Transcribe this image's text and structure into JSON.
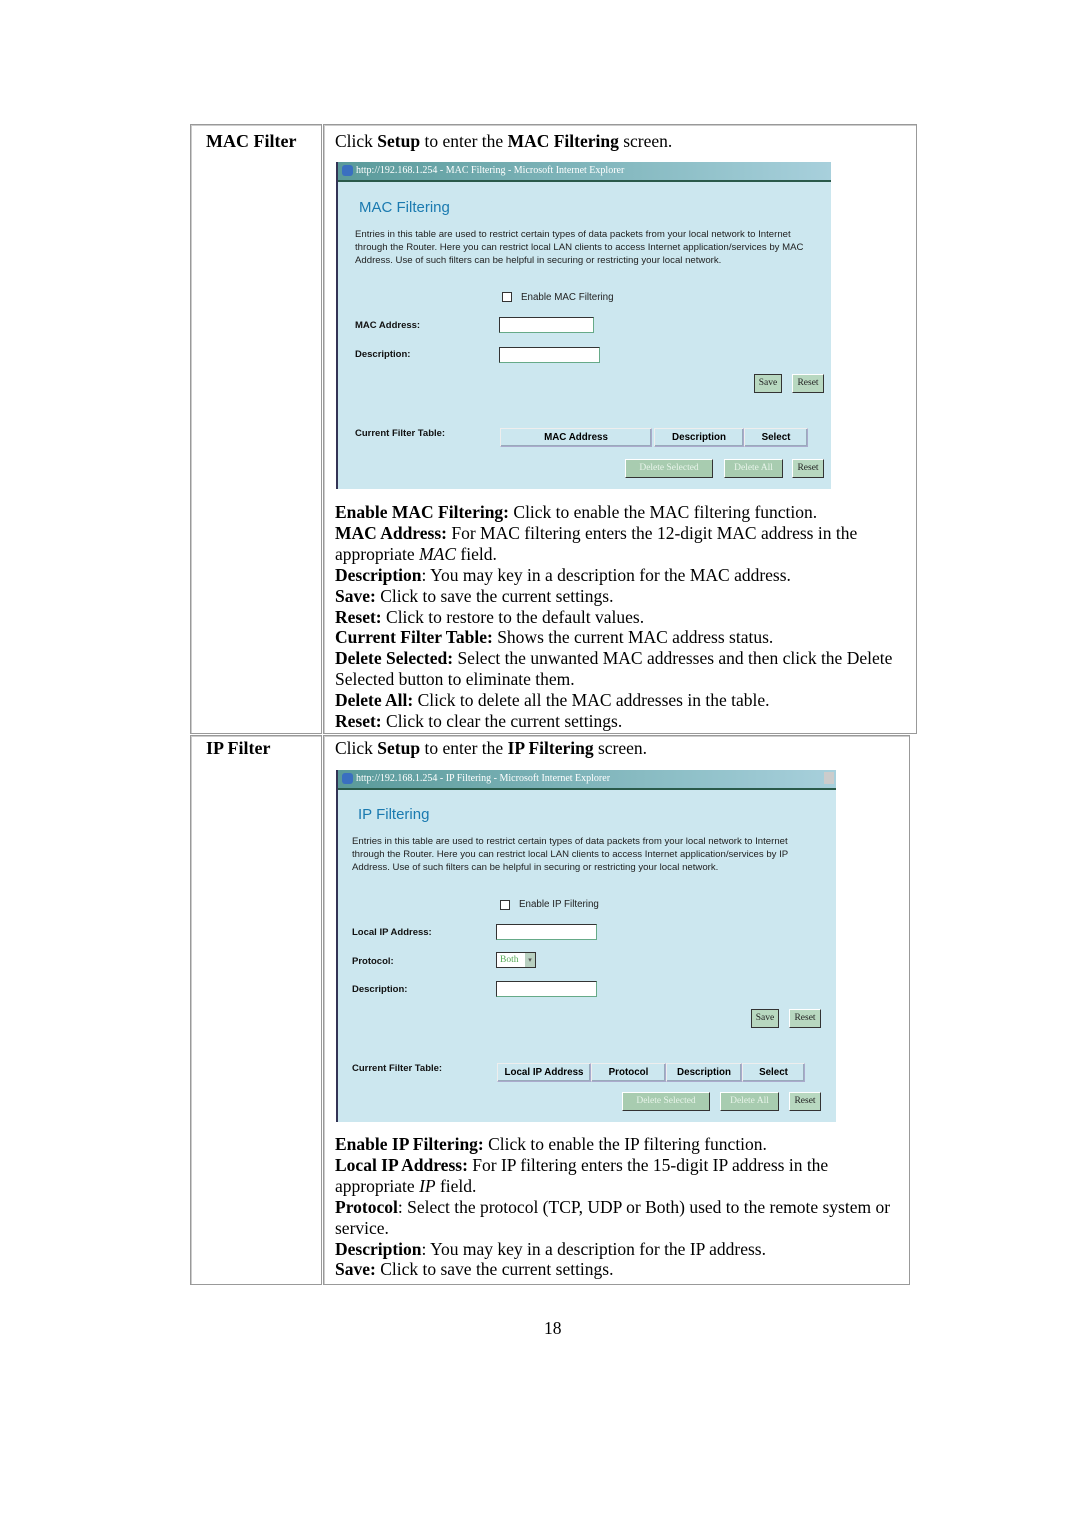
{
  "mac": {
    "label": "MAC Filter",
    "intro": [
      "Click ",
      "Setup",
      " to enter the ",
      "MAC Filtering",
      " screen."
    ],
    "window_title": "http://192.168.1.254 - MAC Filtering - Microsoft Internet Explorer",
    "heading": "MAC Filtering",
    "description": "Entries in this table are used to restrict certain types of data packets from your local network to Internet through the Router. Here you can restrict local LAN clients to access Internet application/services by MAC Address. Use of such filters can be helpful in securing or restricting your local network.",
    "enable_label": "Enable MAC Filtering",
    "enabled": false,
    "mac_label": "MAC Address:",
    "mac_value": "",
    "desc_label": "Description:",
    "desc_value": "",
    "save": "Save",
    "reset": "Reset",
    "table_label": "Current Filter Table:",
    "columns": [
      "MAC Address",
      "Description",
      "Select"
    ],
    "delete_selected": "Delete Selected",
    "delete_all": "Delete All",
    "reset2": "Reset",
    "notes": [
      {
        "term": "Enable MAC Filtering:",
        "text": " Click to enable the MAC filtering function."
      },
      {
        "term": "MAC Address:",
        "text": " For MAC filtering enters the 12-digit MAC address in the appropriate ",
        "em": "MAC",
        "tail": " field."
      },
      {
        "term": "Description",
        "text": ": You may key in a description for the MAC address."
      },
      {
        "term": "Save:",
        "text": " Click to save the current settings."
      },
      {
        "term": "Reset:",
        "text": " Click to restore to the default values."
      },
      {
        "term": "Current Filter Table:",
        "text": " Shows the current MAC address status."
      },
      {
        "term": "Delete Selected:",
        "text": " Select the unwanted MAC addresses and then click the Delete Selected button to eliminate them."
      },
      {
        "term": "Delete All:",
        "text": " Click to delete all the MAC addresses in the table."
      },
      {
        "term": "Reset:",
        "text": " Click to clear the current settings."
      }
    ]
  },
  "ip": {
    "label": "IP Filter",
    "intro": [
      "Click ",
      "Setup",
      " to enter the ",
      "IP Filtering",
      " screen."
    ],
    "window_title": "http://192.168.1.254 - IP Filtering - Microsoft Internet Explorer",
    "heading": "IP Filtering",
    "description": "Entries in this table are used to restrict certain types of data packets from your local network to Internet through the Router. Here you can restrict local LAN clients to access Internet application/services by IP Address. Use of such filters can be helpful in securing or restricting your local network.",
    "enable_label": "Enable IP Filtering",
    "enabled": false,
    "ip_label": "Local IP Address:",
    "ip_value": "",
    "protocol_label": "Protocol:",
    "protocol_value": "Both",
    "desc_label": "Description:",
    "desc_value": "",
    "save": "Save",
    "reset": "Reset",
    "table_label": "Current Filter Table:",
    "columns": [
      "Local IP Address",
      "Protocol",
      "Description",
      "Select"
    ],
    "delete_selected": "Delete Selected",
    "delete_all": "Delete All",
    "reset2": "Reset",
    "notes": [
      {
        "term": "Enable IP Filtering:",
        "text": " Click to enable the IP filtering function."
      },
      {
        "term": "Local IP Address:",
        "text": " For IP filtering enters the 15-digit IP address in the appropriate ",
        "em": "IP",
        "tail": " field."
      },
      {
        "term": "Protocol",
        "text": ": Select the protocol (TCP, UDP or Both) used to the remote system or service."
      },
      {
        "term": "Description",
        "text": ": You may key in a description for the IP address."
      },
      {
        "term": "Save:",
        "text": " Click to save the current settings."
      }
    ]
  },
  "page_number": "18"
}
